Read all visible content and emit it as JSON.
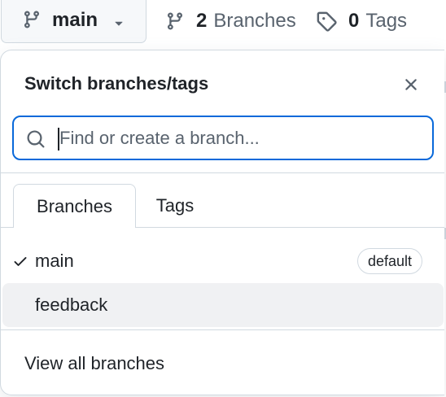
{
  "header": {
    "current_branch": "main",
    "branches_count": "2",
    "branches_label": "Branches",
    "tags_count": "0",
    "tags_label": "Tags"
  },
  "dropdown": {
    "title": "Switch branches/tags",
    "search": {
      "placeholder": "Find or create a branch...",
      "value": ""
    },
    "tabs": [
      {
        "label": "Branches",
        "selected": true
      },
      {
        "label": "Tags",
        "selected": false
      }
    ],
    "branches": [
      {
        "name": "main",
        "checked": true,
        "badge": "default"
      },
      {
        "name": "feedback",
        "checked": false,
        "badge": ""
      }
    ],
    "footer_link": "View all branches"
  },
  "icons": {
    "branch": "git-branch-icon",
    "caret": "triangle-down-icon",
    "tag": "tag-icon",
    "close": "x-icon",
    "search": "search-icon",
    "check": "check-icon"
  },
  "colors": {
    "accent": "#0969da",
    "text": "#1f2328",
    "muted": "#59636e",
    "border": "#d1d9e0",
    "button_bg": "#f6f8fa",
    "hover_bg": "#f0f1f3"
  }
}
